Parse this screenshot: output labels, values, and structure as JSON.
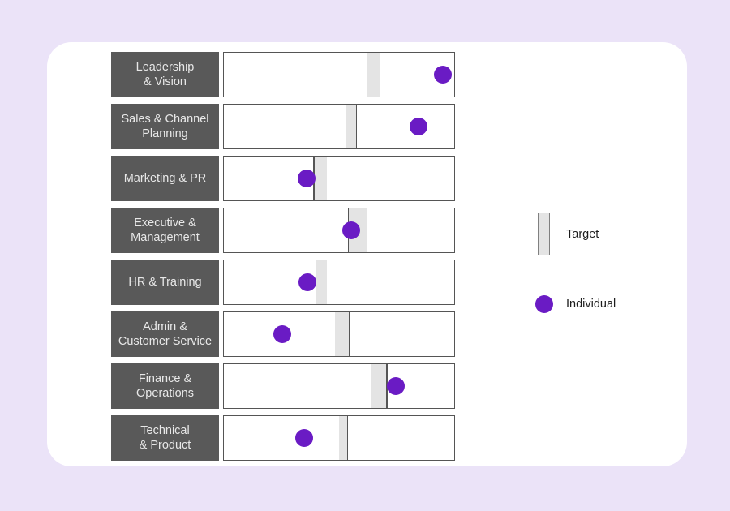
{
  "chart_data": {
    "type": "bar",
    "chart_subtype": "bullet",
    "title": "",
    "xlabel": "",
    "ylabel": "",
    "xlim": [
      0,
      100
    ],
    "grid": false,
    "legend_position": "right",
    "categories": [
      "Leadership\n& Vision",
      "Sales & Channel\nPlanning",
      "Marketing & PR",
      "Executive &\nManagement",
      "HR & Training",
      "Admin &\nCustomer Service",
      "Finance &\nOperations",
      "Technical\n& Product"
    ],
    "series": [
      {
        "name": "Individual",
        "values": [
          94.5,
          84,
          35.5,
          55,
          36,
          25,
          74,
          34.5
        ]
      },
      {
        "name": "Target",
        "values": [
          67,
          57.5,
          41.5,
          59,
          42,
          50,
          74.5,
          51.5
        ]
      }
    ],
    "target_bands": [
      {
        "start": 62,
        "end": 67.5,
        "tick_side": "end"
      },
      {
        "start": 52.5,
        "end": 57.5,
        "tick_side": "end"
      },
      {
        "start": 38.5,
        "end": 44.5,
        "tick_side": "start"
      },
      {
        "start": 53.5,
        "end": 61.5,
        "tick_side": "start"
      },
      {
        "start": 39.5,
        "end": 44.5,
        "tick_side": "start"
      },
      {
        "start": 48,
        "end": 54.5,
        "tick_side": "end"
      },
      {
        "start": 63.5,
        "end": 70.5,
        "tick_side": "end"
      },
      {
        "start": 49.5,
        "end": 53.5,
        "tick_side": "end"
      }
    ]
  },
  "legend": {
    "target_label": "Target",
    "individual_label": "Individual"
  },
  "colors": {
    "background": "#ebe3f8",
    "card": "#ffffff",
    "label_block": "#595959",
    "label_text": "#e8e8e8",
    "track_border": "#555555",
    "target_band": "#e4e4e4",
    "individual_dot": "#6a1bc4",
    "legend_text": "#1c1c1c"
  },
  "rows": [
    {
      "label": "Leadership\n& Vision"
    },
    {
      "label": "Sales & Channel\nPlanning"
    },
    {
      "label": "Marketing & PR"
    },
    {
      "label": "Executive &\nManagement"
    },
    {
      "label": "HR & Training"
    },
    {
      "label": "Admin &\nCustomer Service"
    },
    {
      "label": "Finance &\nOperations"
    },
    {
      "label": "Technical\n& Product"
    }
  ]
}
